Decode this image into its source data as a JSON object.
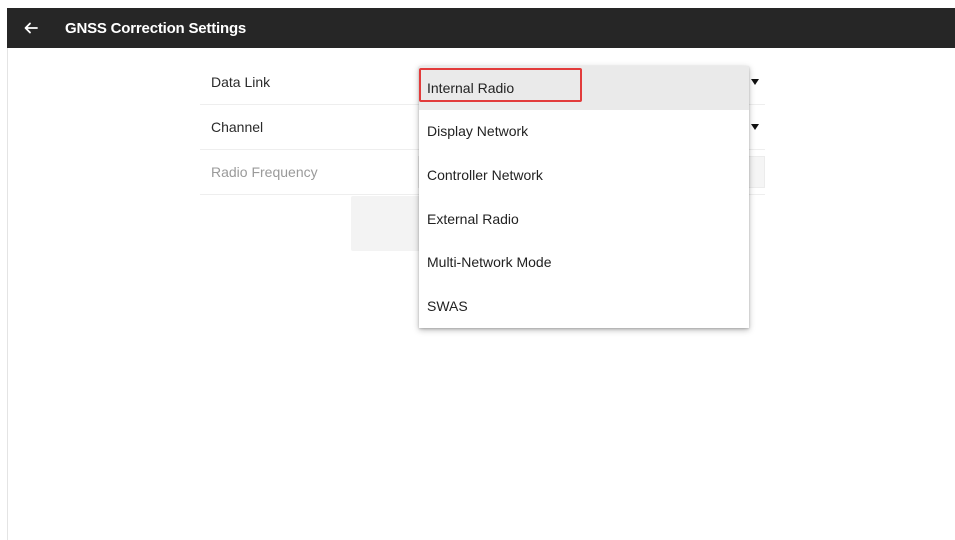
{
  "header": {
    "title": "GNSS Correction Settings",
    "back_icon": "arrow-left-icon"
  },
  "form": {
    "data_link": {
      "label": "Data Link",
      "value": "Internal Radio"
    },
    "channel": {
      "label": "Channel"
    },
    "radio_frequency": {
      "label": "Radio Frequency"
    }
  },
  "dropdown": {
    "selected_index": 0,
    "options": [
      "Internal Radio",
      "Display Network",
      "Controller Network",
      "External Radio",
      "Multi-Network Mode",
      "SWAS"
    ]
  },
  "colors": {
    "topbar": "#262626",
    "highlight": "#e23b3b",
    "selected_row": "#eaeaea"
  }
}
